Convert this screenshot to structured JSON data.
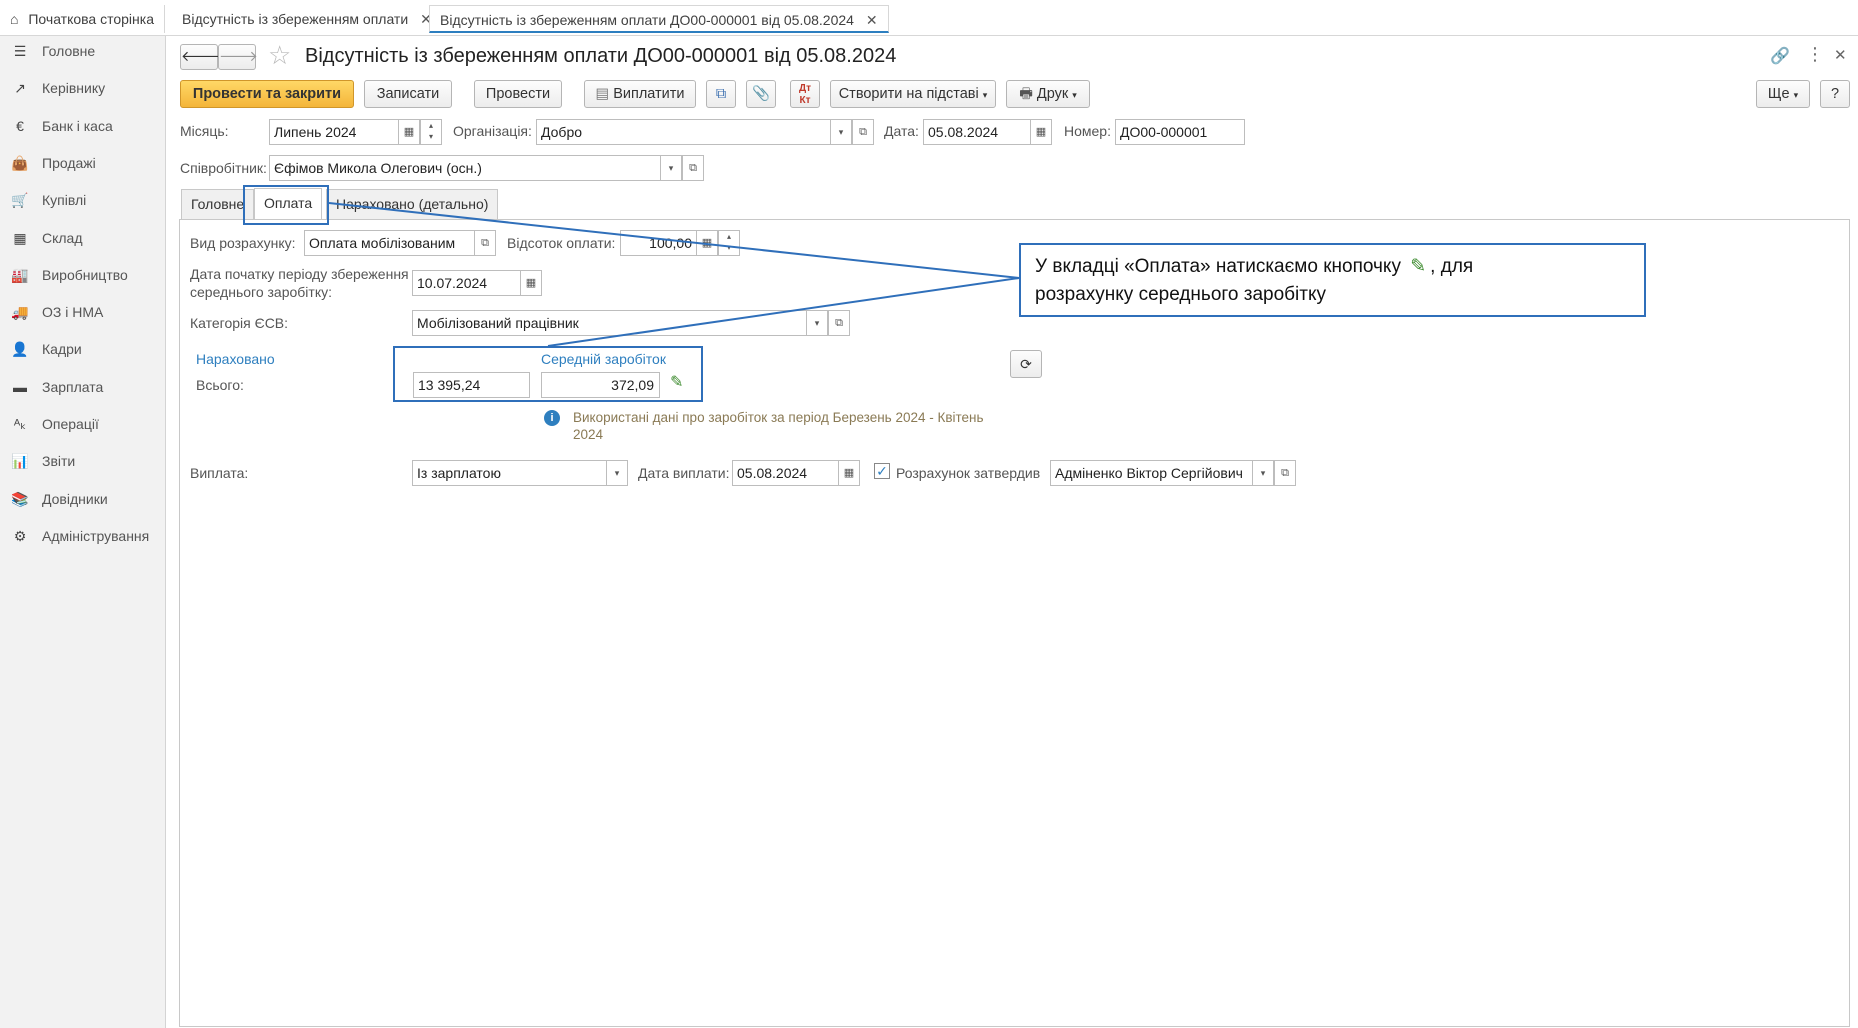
{
  "top_tabs": {
    "home": "Початкова сторінка",
    "tab1": "Відсутність із збереженням оплати",
    "tab2": "Відсутність із збереженням оплати ДО00-000001 від 05.08.2024"
  },
  "sidebar": {
    "items": [
      {
        "label": "Головне",
        "icon": "menu-icon"
      },
      {
        "label": "Керівнику",
        "icon": "trend-icon"
      },
      {
        "label": "Банк і каса",
        "icon": "money-icon"
      },
      {
        "label": "Продажі",
        "icon": "bag-icon"
      },
      {
        "label": "Купівлі",
        "icon": "cart-icon"
      },
      {
        "label": "Склад",
        "icon": "grid-icon"
      },
      {
        "label": "Виробництво",
        "icon": "factory-icon"
      },
      {
        "label": "ОЗ і НМА",
        "icon": "truck-icon"
      },
      {
        "label": "Кадри",
        "icon": "person-icon"
      },
      {
        "label": "Зарплата",
        "icon": "wallet-icon"
      },
      {
        "label": "Операції",
        "icon": "dt-kt-icon"
      },
      {
        "label": "Звіти",
        "icon": "chart-icon"
      },
      {
        "label": "Довідники",
        "icon": "books-icon"
      },
      {
        "label": "Адміністрування",
        "icon": "gear-icon"
      }
    ]
  },
  "header": {
    "title": "Відсутність із збереженням оплати ДО00-000001 від 05.08.2024"
  },
  "toolbar": {
    "post_close": "Провести та закрити",
    "save": "Записати",
    "post": "Провести",
    "pay": "Виплатити",
    "create_based": "Створити на підставі",
    "print": "Друк",
    "more": "Ще",
    "help": "?"
  },
  "form": {
    "month_label": "Місяць:",
    "month_value": "Липень 2024",
    "org_label": "Організація:",
    "org_value": "Добро",
    "date_label": "Дата:",
    "date_value": "05.08.2024",
    "number_label": "Номер:",
    "number_value": "ДО00-000001",
    "employee_label": "Співробітник:",
    "employee_value": "Єфімов Микола Олегович (осн.)"
  },
  "tabs": {
    "main": "Головне",
    "payment": "Оплата",
    "accrued": "Нараховано (детально)"
  },
  "payment_tab": {
    "calc_type_label": "Вид розрахунку:",
    "calc_type_value": "Оплата мобілізованим",
    "percent_label": "Відсоток оплати:",
    "percent_value": "100,00",
    "period_start_label_1": "Дата початку періоду збереження",
    "period_start_label_2": "середнього заробітку:",
    "period_start_value": "10.07.2024",
    "esv_label": "Категорія ЄСВ:",
    "esv_value": "Мобілізований працівник",
    "accrued_header": "Нараховано",
    "avg_header": "Середній заробіток",
    "total_label": "Всього:",
    "total_value": "13 395,24",
    "avg_value": "372,09",
    "info_text_1": "Використані дані про заробіток за період Березень 2024 - Квітень",
    "info_text_2": "2024",
    "payout_label": "Виплата:",
    "payout_value": "Із зарплатою",
    "payout_date_label": "Дата виплати:",
    "payout_date_value": "05.08.2024",
    "approved_label": "Розрахунок затвердив",
    "approved_by": "Адміненко Віктор Сергійович"
  },
  "callout": {
    "text_part1": "У вкладці «Оплата» натискаємо кнопочку",
    "text_part2": ", для",
    "text_line2": "розрахунку середнього заробітку"
  },
  "colors": {
    "primary_button": "#f4b53a",
    "link": "#2e7fbf",
    "callout_border": "#2f6fba",
    "active_tab_underline": "#2d7fc0"
  }
}
